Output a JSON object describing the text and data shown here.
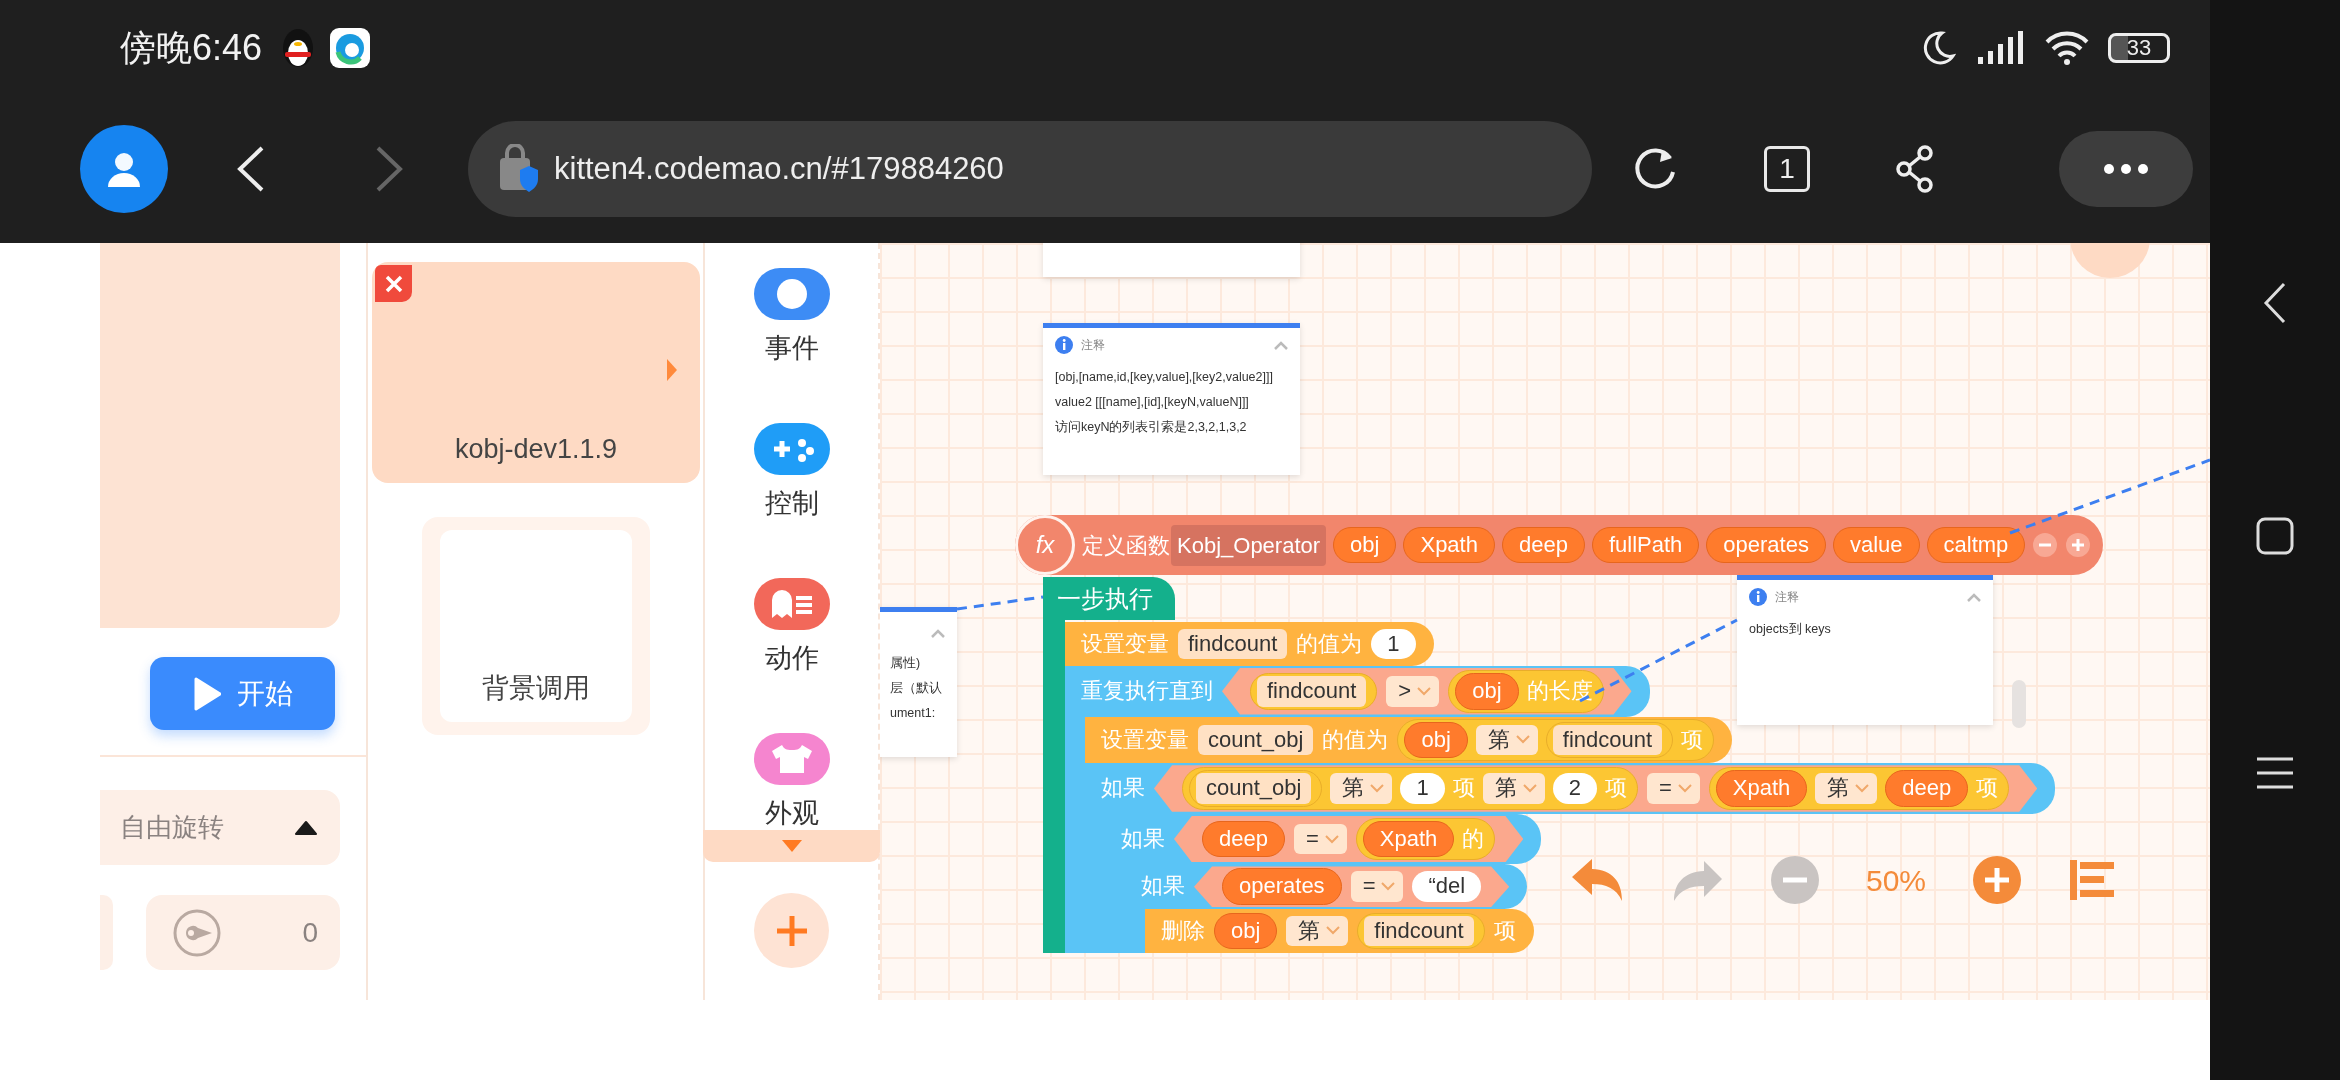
{
  "status_bar": {
    "time": "傍晚6:46",
    "battery": "33"
  },
  "browser": {
    "back_disabled": false,
    "forward_disabled": true,
    "url": "kitten4.codemao.cn/#179884260",
    "tab_count": "1"
  },
  "stage": {
    "start_button": "开始",
    "rotation": "自由旋转",
    "direction": "0"
  },
  "sprites": [
    {
      "name": "kobj-dev1.1.9",
      "selected": true
    }
  ],
  "background": {
    "label": "背景调用"
  },
  "categories": [
    {
      "label": "事件",
      "kind": "toggle",
      "color": "#3d8cf5"
    },
    {
      "label": "控制",
      "kind": "gamepad",
      "color": "#1f9df7"
    },
    {
      "label": "动作",
      "kind": "ghost",
      "color": "#f2685a"
    },
    {
      "label": "外观",
      "kind": "shirt",
      "color": "#f585cf"
    }
  ],
  "comments": [
    {
      "title": "注释",
      "lines": [
        "[obj,[name,id,[key,value],[key2,value2]]]",
        "value2  [[[name],[id],[keyN,valueN]]]",
        "访问keyN的列表引索是2,3,2,1,3,2"
      ]
    },
    {
      "lines": [
        "属性)",
        "层（默认",
        "ument1:"
      ]
    },
    {
      "title": "注释",
      "lines": [
        "objects到 keys"
      ]
    }
  ],
  "function": {
    "badge": "fx",
    "label": "定义函数",
    "name": "Kobj_Operator",
    "params": [
      "obj",
      "Xpath",
      "deep",
      "fullPath",
      "operates",
      "value",
      "caltmp"
    ]
  },
  "script": {
    "label": "一步执行",
    "children": [
      {
        "kind": "set",
        "parts": [
          {
            "kind": "text",
            "text": "设置变量"
          },
          {
            "kind": "var",
            "text": "findcount"
          },
          {
            "kind": "text",
            "text": "的值为"
          },
          {
            "kind": "number",
            "text": "1"
          }
        ]
      },
      {
        "kind": "repeat",
        "parts": [
          {
            "kind": "text",
            "text": "重复执行直到"
          },
          {
            "kind": "condition",
            "parts": [
              {
                "kind": "group",
                "parts": [
                  {
                    "kind": "var",
                    "text": "findcount"
                  }
                ]
              },
              {
                "kind": "dropdown",
                "text": ">"
              },
              {
                "kind": "group",
                "parts": [
                  {
                    "kind": "param",
                    "text": "obj"
                  },
                  {
                    "kind": "text",
                    "text": "的长度"
                  }
                ]
              }
            ]
          }
        ],
        "children": [
          {
            "kind": "set",
            "parts": [
              {
                "kind": "text",
                "text": "设置变量"
              },
              {
                "kind": "var",
                "text": "count_obj"
              },
              {
                "kind": "text",
                "text": "的值为"
              },
              {
                "kind": "group",
                "parts": [
                  {
                    "kind": "param",
                    "text": "obj"
                  },
                  {
                    "kind": "dropdown",
                    "text": "第"
                  },
                  {
                    "kind": "group",
                    "parts": [
                      {
                        "kind": "var",
                        "text": "findcount"
                      }
                    ]
                  },
                  {
                    "kind": "text",
                    "text": "项"
                  }
                ]
              }
            ]
          },
          {
            "kind": "if",
            "parts": [
              {
                "kind": "text",
                "text": "如果"
              },
              {
                "kind": "condition",
                "parts": [
                  {
                    "kind": "group",
                    "parts": [
                      {
                        "kind": "group",
                        "parts": [
                          {
                            "kind": "var",
                            "text": "count_obj"
                          }
                        ]
                      },
                      {
                        "kind": "dropdown",
                        "text": "第"
                      },
                      {
                        "kind": "number",
                        "text": "1"
                      },
                      {
                        "kind": "text",
                        "text": "项"
                      },
                      {
                        "kind": "dropdown",
                        "text": "第"
                      },
                      {
                        "kind": "number",
                        "text": "2"
                      },
                      {
                        "kind": "text",
                        "text": "项"
                      }
                    ]
                  },
                  {
                    "kind": "dropdown",
                    "text": "="
                  },
                  {
                    "kind": "group",
                    "parts": [
                      {
                        "kind": "param",
                        "text": "Xpath"
                      },
                      {
                        "kind": "dropdown",
                        "text": "第"
                      },
                      {
                        "kind": "param",
                        "text": "deep"
                      },
                      {
                        "kind": "text",
                        "text": "项"
                      }
                    ]
                  }
                ]
              }
            ],
            "children": [
              {
                "kind": "if",
                "parts": [
                  {
                    "kind": "text",
                    "text": "如果"
                  },
                  {
                    "kind": "condition",
                    "parts": [
                      {
                        "kind": "param",
                        "text": "deep"
                      },
                      {
                        "kind": "dropdown",
                        "text": "="
                      },
                      {
                        "kind": "group",
                        "parts": [
                          {
                            "kind": "param",
                            "text": "Xpath"
                          },
                          {
                            "kind": "text",
                            "text": "的"
                          }
                        ]
                      }
                    ]
                  }
                ],
                "children": [
                  {
                    "kind": "if",
                    "parts": [
                      {
                        "kind": "text",
                        "text": "如果"
                      },
                      {
                        "kind": "condition",
                        "parts": [
                          {
                            "kind": "param",
                            "text": "operates"
                          },
                          {
                            "kind": "dropdown",
                            "text": "="
                          },
                          {
                            "kind": "string",
                            "text": "“del"
                          }
                        ]
                      }
                    ],
                    "children": [
                      {
                        "kind": "delete",
                        "parts": [
                          {
                            "kind": "text",
                            "text": "删除"
                          },
                          {
                            "kind": "param",
                            "text": "obj"
                          },
                          {
                            "kind": "dropdown",
                            "text": "第"
                          },
                          {
                            "kind": "group",
                            "parts": [
                              {
                                "kind": "var",
                                "text": "findcount"
                              }
                            ]
                          },
                          {
                            "kind": "text",
                            "text": "项"
                          }
                        ]
                      }
                    ]
                  }
                ]
              }
            ]
          }
        ]
      }
    ]
  },
  "zoom": {
    "percent": "50%"
  }
}
